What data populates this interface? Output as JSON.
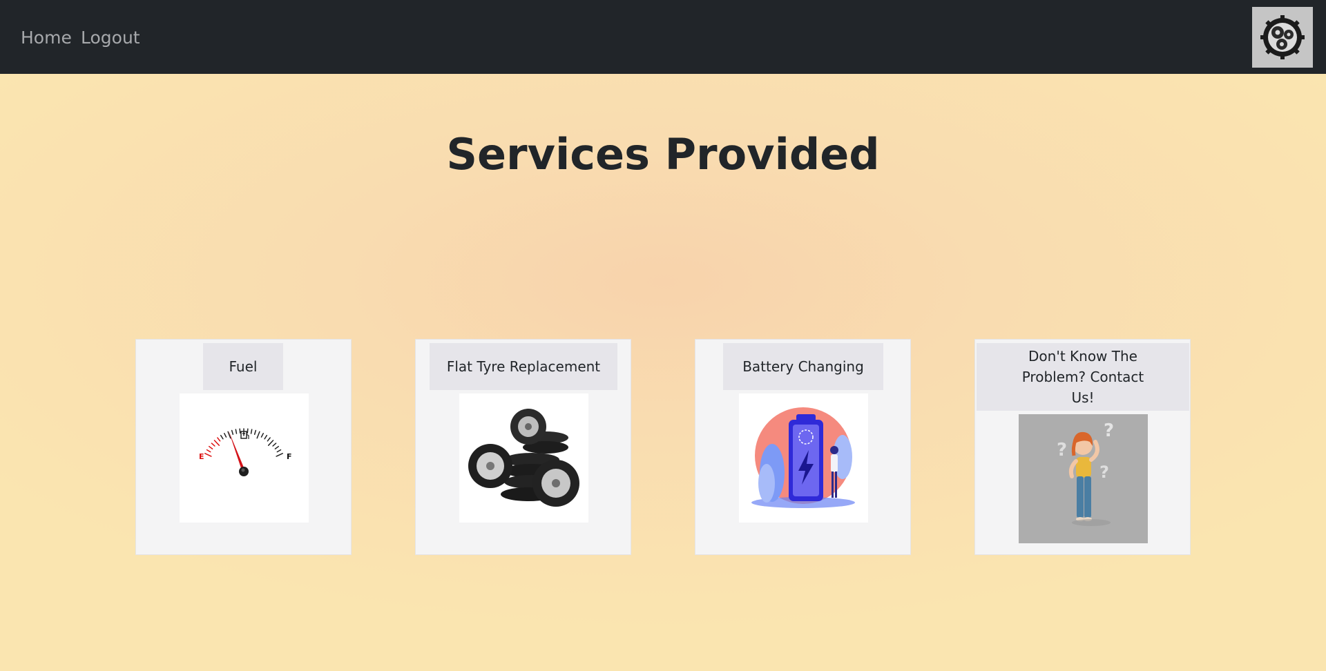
{
  "nav": {
    "links": [
      {
        "label": "Home"
      },
      {
        "label": "Logout"
      }
    ],
    "logo_icon": "gear-cluster-icon"
  },
  "page": {
    "title": "Services Provided"
  },
  "services": [
    {
      "label": "Fuel",
      "icon": "fuel-gauge-icon"
    },
    {
      "label": "Flat Tyre Replacement",
      "icon": "tyre-stack-icon"
    },
    {
      "label": "Battery Changing",
      "icon": "battery-charging-icon"
    },
    {
      "label": "Don't Know The Problem? Contact Us!",
      "icon": "confused-person-icon"
    }
  ],
  "colors": {
    "navbar_bg": "#212529",
    "nav_link": "#a7a9ac",
    "card_bg": "#f4f4f5",
    "card_header_bg": "#e6e5ea",
    "page_bg": "#fae5b0"
  }
}
